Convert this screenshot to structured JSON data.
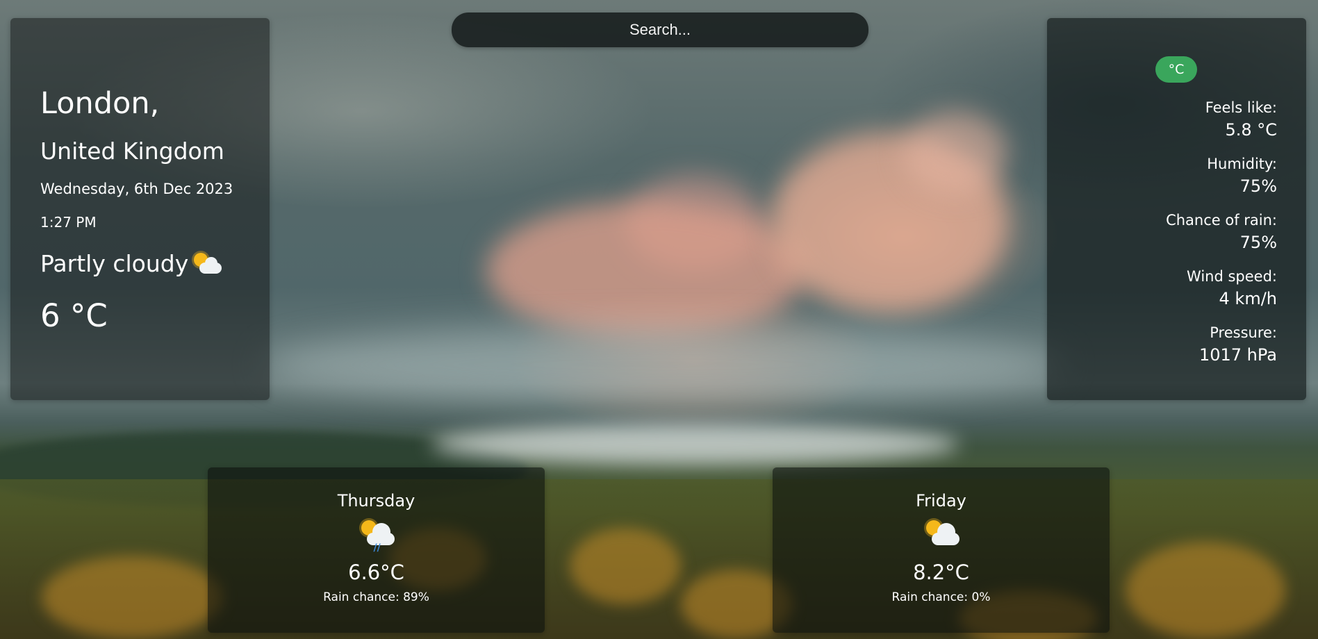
{
  "search": {
    "placeholder": "Search..."
  },
  "location": {
    "city": "London,",
    "country": "United Kingdom"
  },
  "current": {
    "date": "Wednesday, 6th Dec 2023",
    "time": "1:27 PM",
    "condition": "Partly cloudy",
    "condition_icon": "partly-cloudy-icon",
    "temperature": "6 °C"
  },
  "unit_toggle": {
    "label": "°C",
    "color": "#3aa65c"
  },
  "stats": {
    "feels_like": {
      "label": "Feels like:",
      "value": "5.8 °C"
    },
    "humidity": {
      "label": "Humidity:",
      "value": "75%"
    },
    "rain": {
      "label": "Chance of rain:",
      "value": "75%"
    },
    "wind": {
      "label": "Wind speed:",
      "value": "4 km/h"
    },
    "pressure": {
      "label": "Pressure:",
      "value": "1017 hPa"
    }
  },
  "forecast": [
    {
      "day": "Thursday",
      "icon": "patchy-rain-icon",
      "temp": "6.6°C",
      "rain": "Rain chance: 89%"
    },
    {
      "day": "Friday",
      "icon": "partly-cloudy-icon",
      "temp": "8.2°C",
      "rain": "Rain chance: 0%"
    }
  ]
}
